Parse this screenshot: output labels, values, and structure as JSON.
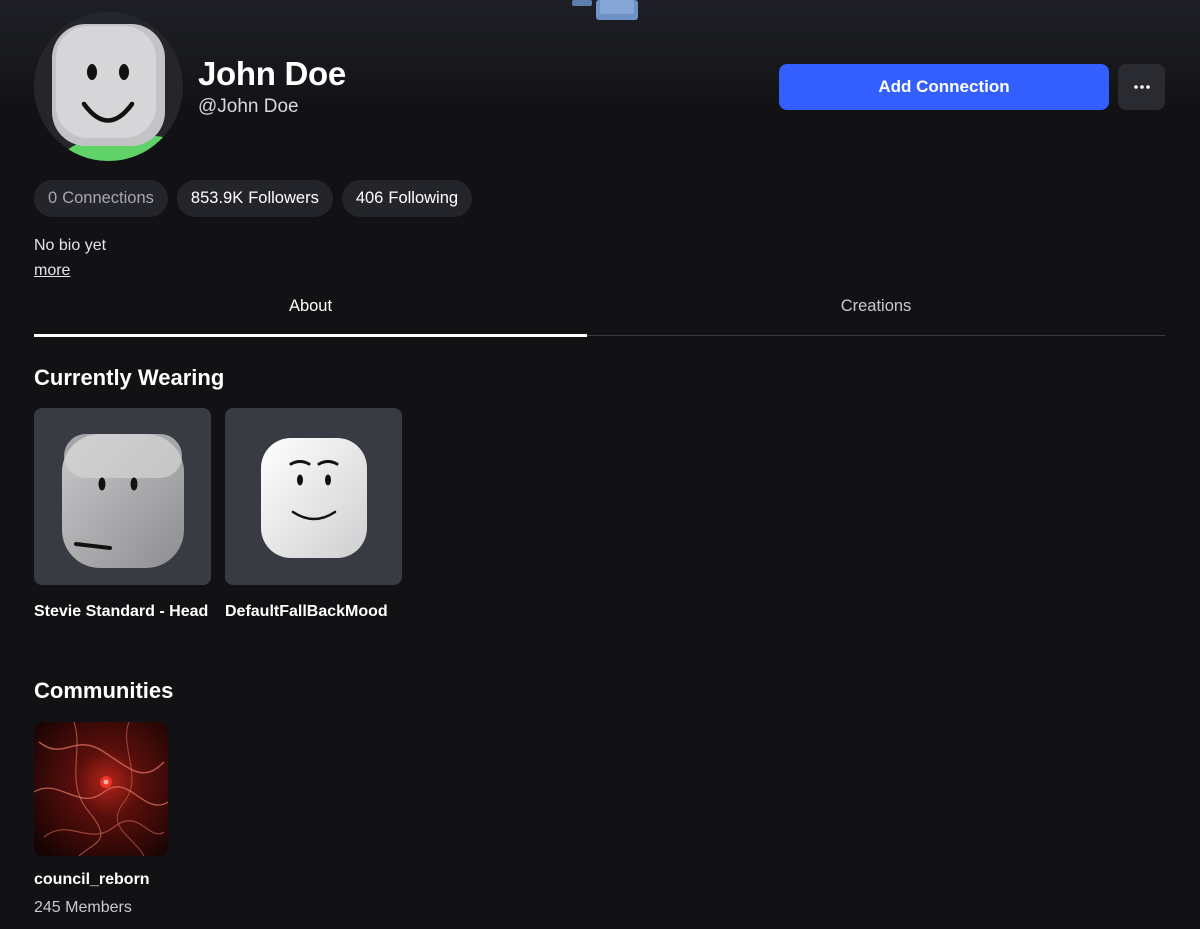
{
  "profile": {
    "display_name": "John Doe",
    "username": "@John Doe",
    "bio": "No bio yet",
    "more_label": "more"
  },
  "actions": {
    "add_connection_label": "Add Connection",
    "more_options_icon": "ellipsis-icon"
  },
  "stats": {
    "connections_count": "0",
    "connections_label": "Connections",
    "followers_count": "853.9K",
    "followers_label": "Followers",
    "following_count": "406",
    "following_label": "Following"
  },
  "tabs": [
    {
      "label": "About",
      "active": true
    },
    {
      "label": "Creations",
      "active": false
    }
  ],
  "currently_wearing": {
    "title": "Currently Wearing",
    "items": [
      {
        "name": "Stevie Standard - Head"
      },
      {
        "name": "DefaultFallBackMood"
      }
    ]
  },
  "communities": {
    "title": "Communities",
    "items": [
      {
        "name": "council_reborn",
        "members": "245 Members"
      }
    ]
  },
  "colors": {
    "background": "#121215",
    "accent": "#335fff",
    "pill": "#24252b",
    "card": "#393b43"
  }
}
